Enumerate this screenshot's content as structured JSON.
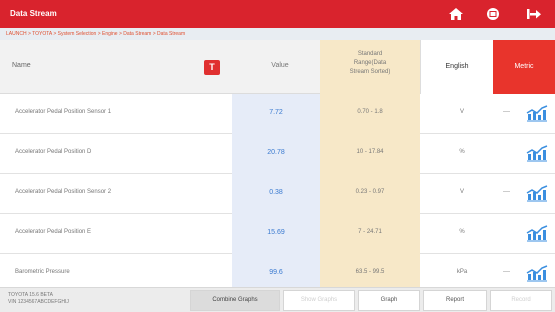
{
  "header": {
    "title": "Data Stream",
    "breadcrumb": "LAUNCH > TOYOTA > System Selection > Engine > Data Stream > Data Stream",
    "icons": [
      "home-icon",
      "print-icon",
      "exit-icon"
    ]
  },
  "table": {
    "col_name": "Name",
    "col_value": "Value",
    "col_std": [
      "Standard",
      "Range(Data",
      "Stream Sorted)"
    ],
    "unit_tabs": [
      "English",
      "Metric"
    ],
    "active_unit": "Metric",
    "rows": [
      {
        "name": "Accelerator Pedal Position Sensor 1",
        "value": "7.72",
        "std": "0.70 - 1.8",
        "unit": "V",
        "dash": "—"
      },
      {
        "name": "Accelerator Pedal Position D",
        "value": "20.78",
        "std": "10 - 17.84",
        "unit": "%",
        "dash": ""
      },
      {
        "name": "Accelerator Pedal Position Sensor 2",
        "value": "0.38",
        "std": "0.23 - 0.97",
        "unit": "V",
        "dash": "—"
      },
      {
        "name": "Accelerator Pedal Position E",
        "value": "15.69",
        "std": "7 - 24.71",
        "unit": "%",
        "dash": ""
      },
      {
        "name": "Barometric Pressure",
        "value": "99.6",
        "std": "63.5 - 99.5",
        "unit": "kPa",
        "dash": "—"
      }
    ]
  },
  "footer": {
    "info_line1": "TOYOTA 15.6 BETA",
    "info_line2": "VIN 1234567ABCDEFGHIJ",
    "buttons": [
      "Combine Graphs",
      "Show Graphs",
      "Graph",
      "Report",
      "Record"
    ]
  },
  "colors": {
    "brand_red": "#d9232d",
    "value_blue": "#3a7ad0",
    "std_bg": "#f7e8c8"
  }
}
